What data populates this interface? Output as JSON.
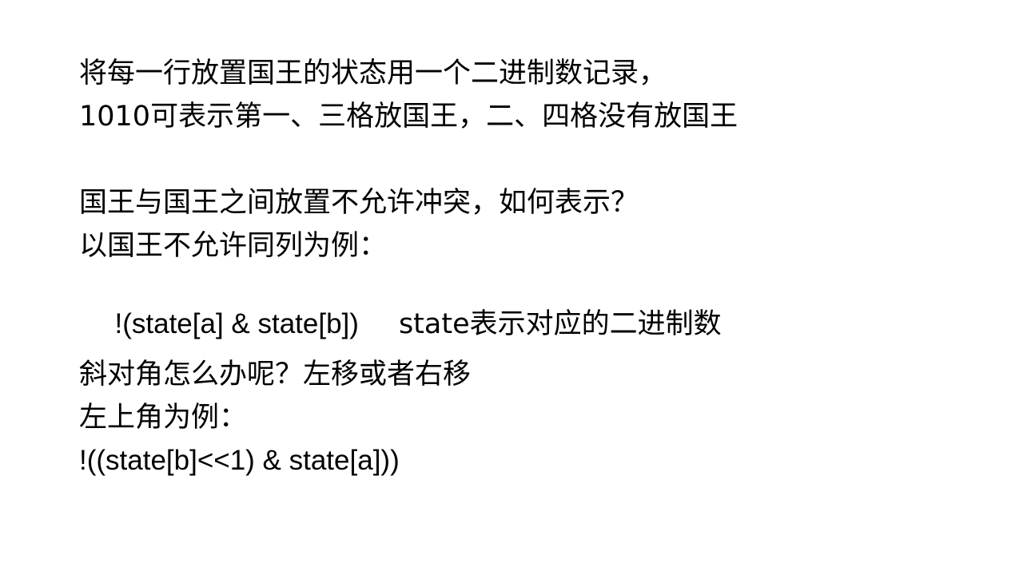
{
  "slide": {
    "section1": {
      "line1": "将每一行放置国王的状态用一个二进制数记录，",
      "line2": "1010可表示第一、三格放国王，二、四格没有放国王"
    },
    "section2": {
      "line1": "国王与国王之间放置不允许冲突，如何表示？",
      "line2": "以国王不允许同列为例：",
      "code": "!(state[a] & state[b])",
      "code_note": "state表示对应的二进制数"
    },
    "section3": {
      "line1": "斜对角怎么办呢？左移或者右移",
      "line2": "左上角为例：",
      "code": "!((state[b]<<1) & state[a]))"
    }
  }
}
